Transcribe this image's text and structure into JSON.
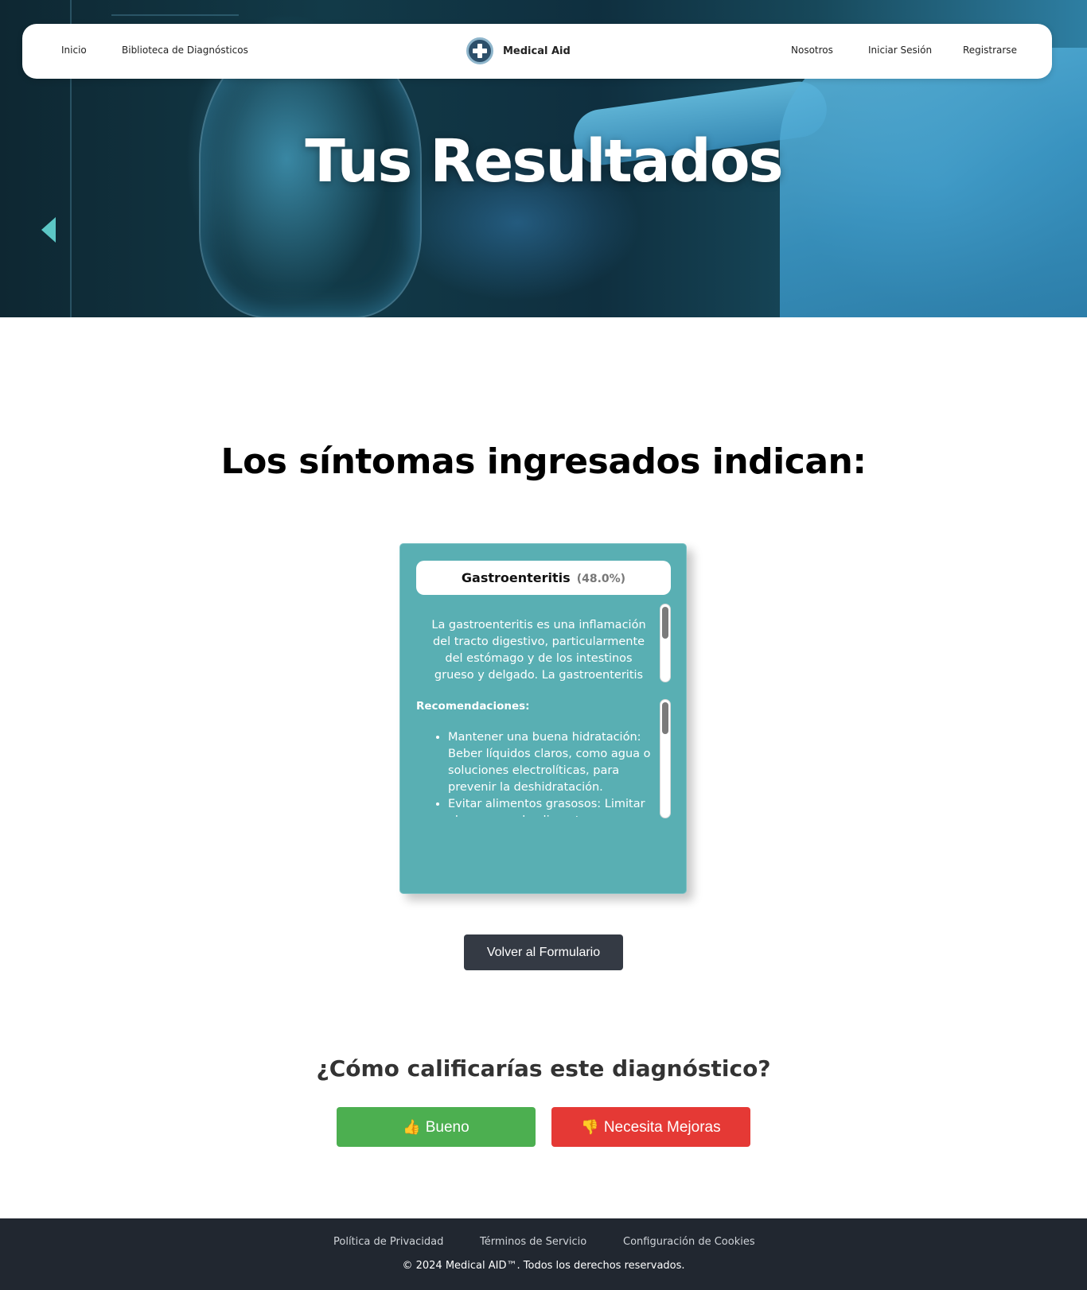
{
  "nav": {
    "inicio": "Inicio",
    "biblioteca": "Biblioteca de Diagnósticos",
    "brand": "Medical Aid",
    "nosotros": "Nosotros",
    "login": "Iniciar Sesión",
    "register": "Registrarse"
  },
  "hero": {
    "title": "Tus Resultados"
  },
  "results": {
    "heading": "Los síntomas ingresados indican:",
    "diagnosis_name": "Gastroenteritis",
    "diagnosis_pct": "(48.0%)",
    "description": "La gastroenteritis es una inflamación del tracto digestivo, particularmente del estómago y de los intestinos grueso y delgado. La gastroenteritis viral y",
    "recommendations_title": "Recomendaciones:",
    "recommendations": [
      "Mantener una buena hidratación: Beber líquidos claros, como agua o soluciones electrolíticas, para prevenir la deshidratación.",
      "Evitar alimentos grasosos: Limitar el consumo de alimentos"
    ],
    "back_button": "Volver al Formulario"
  },
  "rating": {
    "question": "¿Cómo calificarías este diagnóstico?",
    "good_icon": "thumbs-up-icon",
    "good_label": "Bueno",
    "bad_icon": "thumbs-down-icon",
    "bad_label": "Necesita Mejoras"
  },
  "footer": {
    "privacy": "Política de Privacidad",
    "terms": "Términos de Servicio",
    "cookies": "Configuración de Cookies",
    "copyright": "© 2024 Medical AID™. Todos los derechos reservados."
  },
  "colors": {
    "card": "#59afb3",
    "good": "#4caf50",
    "bad": "#e53935",
    "footer": "#212730",
    "back_button": "#343a44"
  }
}
